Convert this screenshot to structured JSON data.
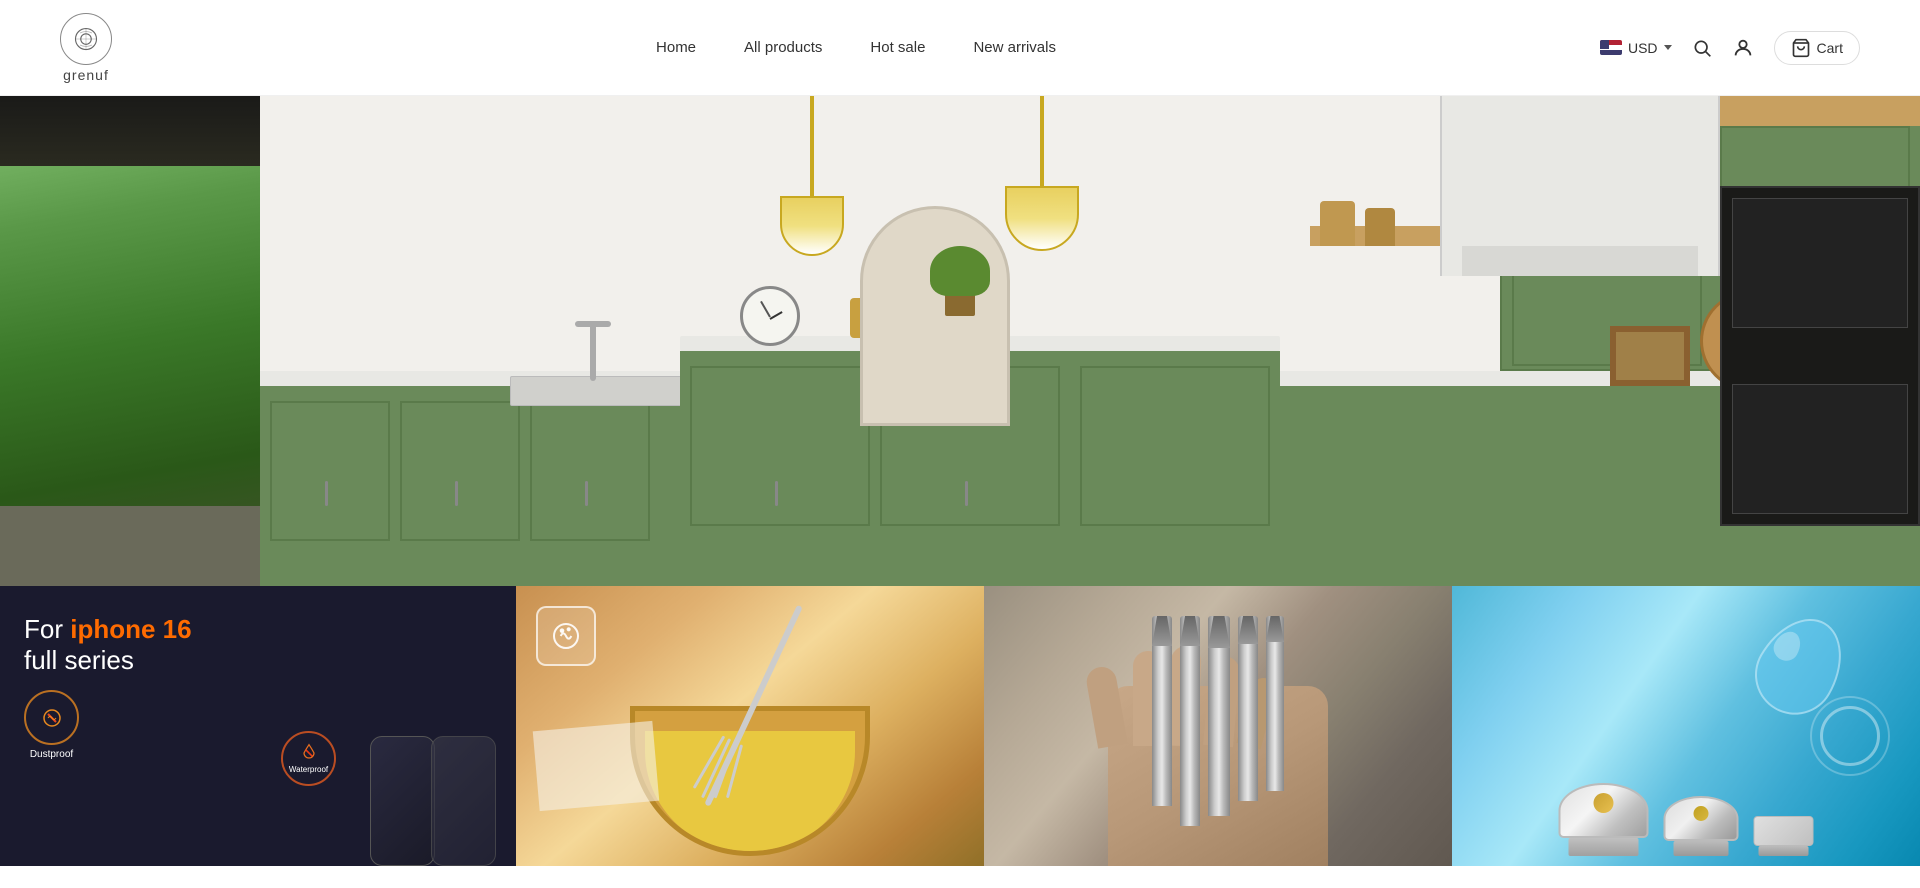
{
  "brand": {
    "name": "grenuf",
    "logo_alt": "grenuf logo"
  },
  "nav": {
    "items": [
      {
        "label": "Home",
        "href": "#"
      },
      {
        "label": "All products",
        "href": "#"
      },
      {
        "label": "Hot sale",
        "href": "#"
      },
      {
        "label": "New arrivals",
        "href": "#"
      }
    ]
  },
  "header": {
    "currency": "USD",
    "currency_flag": "US",
    "cart_label": "Cart",
    "search_placeholder": "Search"
  },
  "hero": {
    "alt": "Modern kitchen with green cabinets and large windows"
  },
  "products": [
    {
      "id": "iphone16",
      "title_line1": "For iphone 16",
      "title_line2": "full series",
      "highlight": "iphone 16",
      "badge1": "Dustproof",
      "badge2": "Waterproof",
      "bg": "#1a1a2e",
      "alt": "iPhone 16 full series case"
    },
    {
      "id": "cooking",
      "alt": "Cooking whisk with yellow batter in bowl",
      "bg": "#d4a060"
    },
    {
      "id": "drill",
      "alt": "Metal drill bits close up in hand",
      "bg": "#8a7a6a"
    },
    {
      "id": "drain",
      "alt": "Chrome drain plugs on blue background",
      "bg": "#50b8d8"
    }
  ]
}
